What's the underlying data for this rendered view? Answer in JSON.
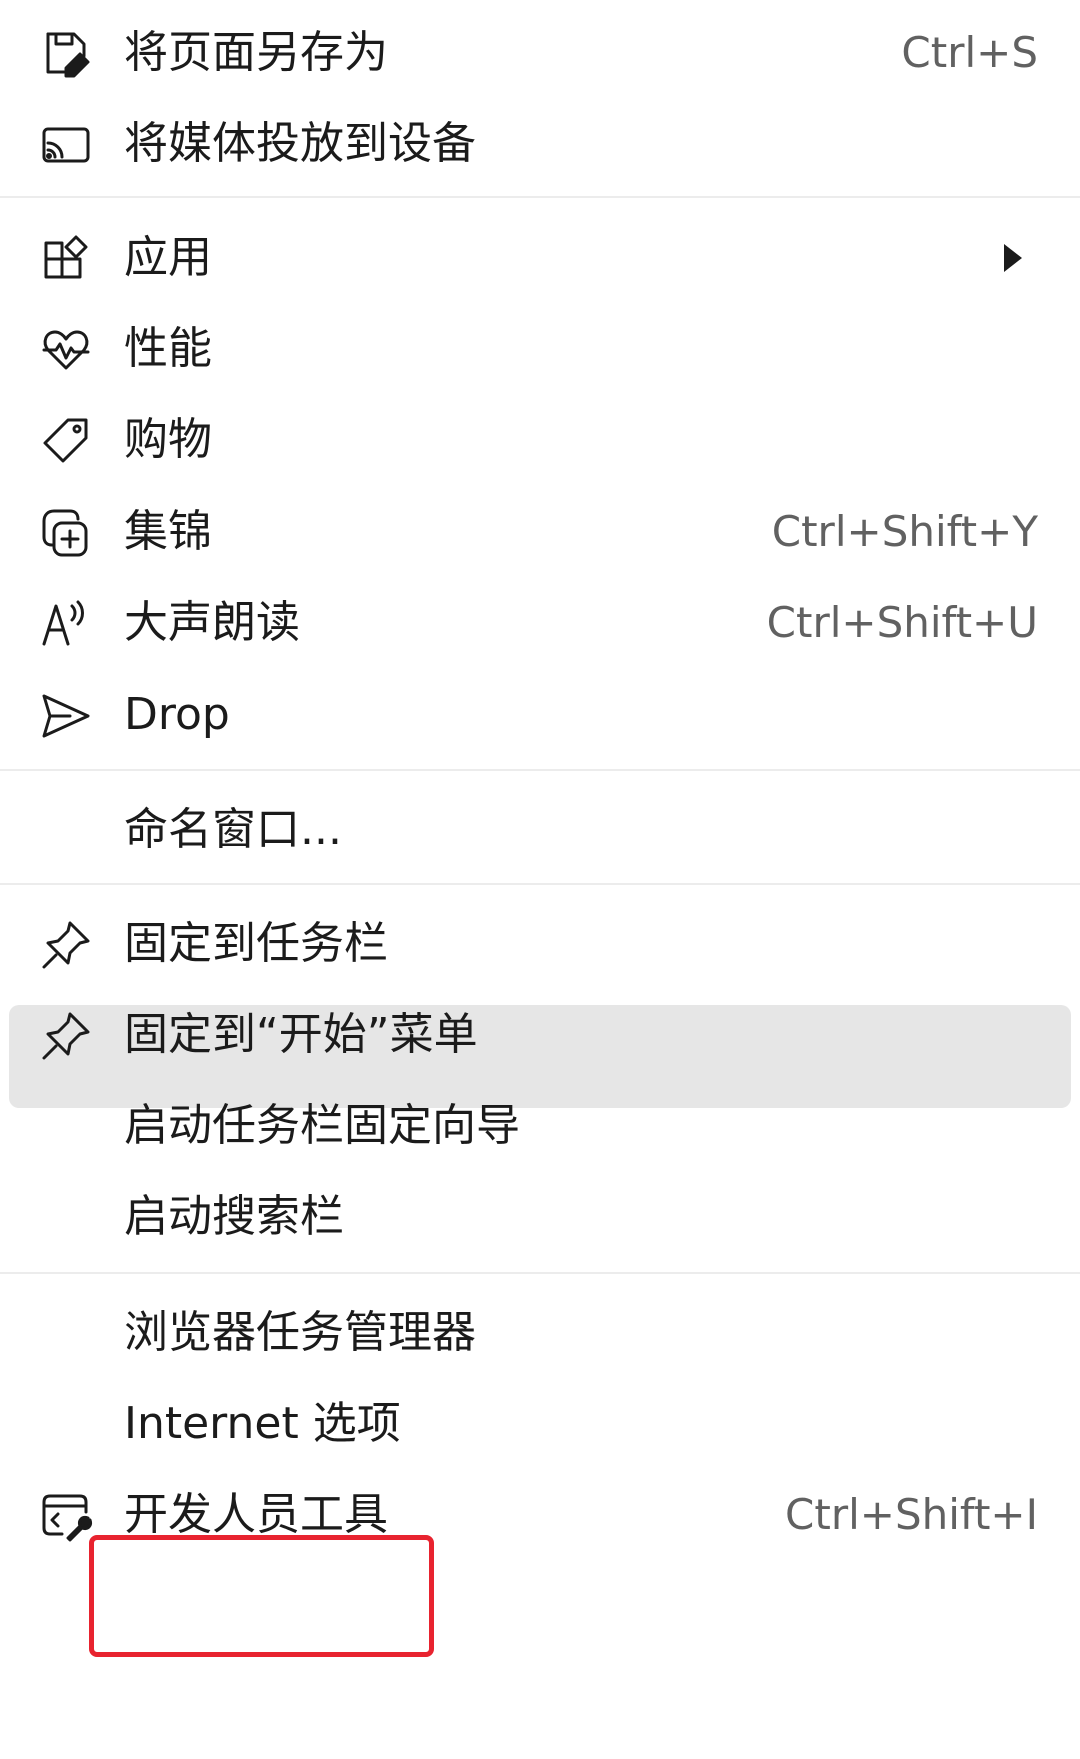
{
  "menu": {
    "items": [
      {
        "icon": "save-page-icon",
        "label": "将页面另存为",
        "shortcut": "Ctrl+S"
      },
      {
        "icon": "cast-icon",
        "label": "将媒体投放到设备",
        "shortcut": ""
      },
      {
        "icon": "apps-icon",
        "label": "应用",
        "shortcut": ""
      },
      {
        "icon": "heart-pulse-icon",
        "label": "性能",
        "shortcut": ""
      },
      {
        "icon": "tag-icon",
        "label": "购物",
        "shortcut": ""
      },
      {
        "icon": "collections-icon",
        "label": "集锦",
        "shortcut": "Ctrl+Shift+Y"
      },
      {
        "icon": "read-aloud-icon",
        "label": "大声朗读",
        "shortcut": "Ctrl+Shift+U"
      },
      {
        "icon": "send-icon",
        "label": "Drop",
        "shortcut": ""
      },
      {
        "icon": "",
        "label": "命名窗口...",
        "shortcut": ""
      },
      {
        "icon": "pin-icon",
        "label": "固定到任务栏",
        "shortcut": ""
      },
      {
        "icon": "pin-icon",
        "label": "固定到“开始”菜单",
        "shortcut": ""
      },
      {
        "icon": "",
        "label": "启动任务栏固定向导",
        "shortcut": ""
      },
      {
        "icon": "",
        "label": "启动搜索栏",
        "shortcut": ""
      },
      {
        "icon": "",
        "label": "浏览器任务管理器",
        "shortcut": ""
      },
      {
        "icon": "",
        "label": "Internet 选项",
        "shortcut": ""
      },
      {
        "icon": "dev-tools-icon",
        "label": "开发人员工具",
        "shortcut": "Ctrl+Shift+I"
      }
    ],
    "hovered_item": "固定到任务栏",
    "highlighted_item": "Internet 选项"
  },
  "colors": {
    "hover_background": "#e6e6e6",
    "highlight_border": "#e8232f",
    "shortcut_text": "#616161"
  }
}
